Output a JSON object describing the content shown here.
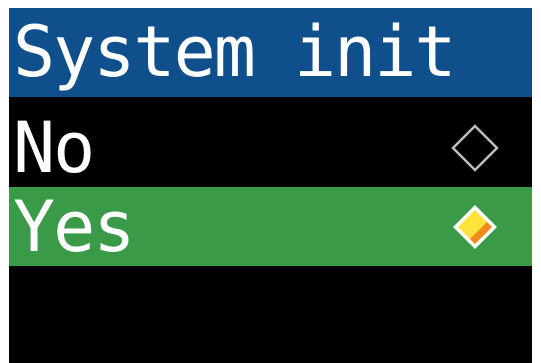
{
  "screen": {
    "title": "System init",
    "title_bar_color": "#0f4f8c",
    "background_color": "#000000"
  },
  "menu": {
    "items": [
      {
        "label": "No",
        "selected": false,
        "icon": "diamond-outline-icon"
      },
      {
        "label": "Yes",
        "selected": true,
        "highlight_color": "#3a9a48",
        "icon": "diamond-filled-icon",
        "icon_colors": [
          "#ffe33d",
          "#f08a1c"
        ]
      }
    ]
  }
}
